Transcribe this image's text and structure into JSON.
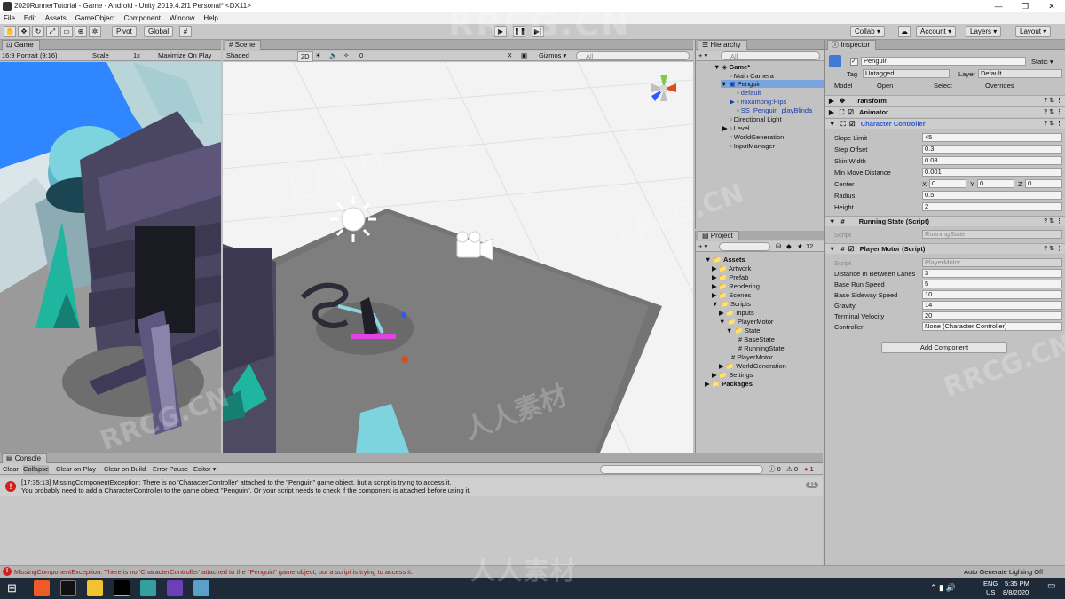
{
  "window": {
    "title": "2020RunnerTutorial - Game - Android - Unity 2019.4.2f1 Personal* <DX11>",
    "minimize": "—",
    "maximize": "❐",
    "close": "✕"
  },
  "menu": [
    "File",
    "Edit",
    "Assets",
    "GameObject",
    "Component",
    "Window",
    "Help"
  ],
  "toolbar": {
    "pivot": "Pivot",
    "global": "Global",
    "play": "▶",
    "pause": "❚❚",
    "step": "▶|",
    "collab": "Collab ▾",
    "account": "Account ▾",
    "layers": "Layers ▾",
    "layout": "Layout ▾"
  },
  "game": {
    "tab": "Game",
    "resolution": "16:9 Portrait (9:16)",
    "scale_label": "Scale",
    "scale_value": "1x",
    "maximize_on_play": "Maximize On Play"
  },
  "scene": {
    "tab": "Scene",
    "shading": "Shaded",
    "mode": "2D",
    "gizmos": "Gizmos ▾",
    "search_placeholder": "All",
    "layers_count": "0"
  },
  "hierarchy": {
    "tab": "Hierarchy",
    "search_placeholder": "All",
    "items": [
      {
        "label": "Game*",
        "depth": 0,
        "arrow": "▼",
        "scene": true
      },
      {
        "label": "Main Camera",
        "depth": 1,
        "arrow": ""
      },
      {
        "label": "Penguin",
        "depth": 1,
        "arrow": "▼",
        "selected": true
      },
      {
        "label": "default",
        "depth": 2,
        "arrow": "",
        "prefab": true
      },
      {
        "label": "mixamorig:Hips",
        "depth": 2,
        "arrow": "▶",
        "prefab": true
      },
      {
        "label": "SS_Penguin_playBlinda",
        "depth": 2,
        "arrow": "",
        "prefab": true
      },
      {
        "label": "Directional Light",
        "depth": 1,
        "arrow": ""
      },
      {
        "label": "Level",
        "depth": 1,
        "arrow": "▶"
      },
      {
        "label": "WorldGeneration",
        "depth": 1,
        "arrow": ""
      },
      {
        "label": "InputManager",
        "depth": 1,
        "arrow": ""
      }
    ]
  },
  "project": {
    "tab": "Project",
    "count": "12",
    "items": [
      {
        "label": "Assets",
        "depth": 0,
        "arrow": "▼",
        "bold": true
      },
      {
        "label": "Artwork",
        "depth": 1,
        "arrow": "▶"
      },
      {
        "label": "Prefab",
        "depth": 1,
        "arrow": "▶"
      },
      {
        "label": "Rendering",
        "depth": 1,
        "arrow": "▶"
      },
      {
        "label": "Scenes",
        "depth": 1,
        "arrow": "▶"
      },
      {
        "label": "Scripts",
        "depth": 1,
        "arrow": "▼"
      },
      {
        "label": "Inputs",
        "depth": 2,
        "arrow": "▶"
      },
      {
        "label": "PlayerMotor",
        "depth": 2,
        "arrow": "▼"
      },
      {
        "label": "State",
        "depth": 3,
        "arrow": "▼"
      },
      {
        "label": "BaseState",
        "depth": 4,
        "arrow": "",
        "script": true
      },
      {
        "label": "RunningState",
        "depth": 4,
        "arrow": "",
        "script": true
      },
      {
        "label": "PlayerMotor",
        "depth": 3,
        "arrow": "",
        "script": true
      },
      {
        "label": "WorldGeneration",
        "depth": 2,
        "arrow": "▶"
      },
      {
        "label": "Settings",
        "depth": 1,
        "arrow": "▶"
      },
      {
        "label": "Packages",
        "depth": 0,
        "arrow": "▶",
        "bold": true
      }
    ]
  },
  "inspector": {
    "tab": "Inspector",
    "object_name": "Penguin",
    "static_label": "Static ▾",
    "tag_label": "Tag",
    "tag_value": "Untagged",
    "layer_label": "Layer",
    "layer_value": "Default",
    "model_label": "Model",
    "open_label": "Open",
    "select_label": "Select",
    "overrides_label": "Overrides",
    "transform": "Transform",
    "animator": "Animator",
    "character_controller": "Character Controller",
    "cc_fields": [
      {
        "label": "Slope Limit",
        "value": "45"
      },
      {
        "label": "Step Offset",
        "value": "0.3"
      },
      {
        "label": "Skin Width",
        "value": "0.08"
      },
      {
        "label": "Min Move Distance",
        "value": "0.001"
      }
    ],
    "center_label": "Center",
    "center_x": "0",
    "center_y": "0",
    "center_z": "0",
    "radius_label": "Radius",
    "radius_value": "0.5",
    "height_label": "Height",
    "height_value": "2",
    "running_state": "Running State (Script)",
    "running_script_label": "Script",
    "running_script_value": "RunningState",
    "player_motor": "Player Motor (Script)",
    "motor_script_label": "Script",
    "motor_script_value": "PlayerMotor",
    "motor_fields": [
      {
        "label": "Distance In Between Lanes",
        "value": "3"
      },
      {
        "label": "Base Run Speed",
        "value": "5"
      },
      {
        "label": "Base Sideway Speed",
        "value": "10"
      },
      {
        "label": "Gravity",
        "value": "14"
      },
      {
        "label": "Terminal Velocity",
        "value": "20"
      },
      {
        "label": "Controller",
        "value": "None (Character Controller)"
      }
    ],
    "add_component": "Add Component"
  },
  "console": {
    "tab": "Console",
    "clear": "Clear",
    "collapse": "Collapse",
    "clear_on_play": "Clear on Play",
    "clear_on_build": "Clear on Build",
    "error_pause": "Error Pause",
    "editor": "Editor ▾",
    "log_count": "0",
    "warn_count": "0",
    "err_count": "1",
    "message_line1": "[17:35:13] MissingComponentException: There is no 'CharacterController' attached to the \"Penguin\" game object, but a script is trying to access it.",
    "message_line2": "You probably need to add a CharacterController to the game object \"Penguin\". Or your script needs to check if the component is attached before using it.",
    "message_count": "81"
  },
  "status": {
    "message": "MissingComponentException: There is no 'CharacterController' attached to the \"Penguin\" game object, but a script is trying to access it.",
    "right": "Auto Generate Lighting Off"
  },
  "taskbar": {
    "lang1": "ENG",
    "lang2": "US",
    "time": "5:35 PM",
    "date": "8/8/2020"
  },
  "watermark": {
    "text1": "RRCG.CN",
    "text2": "人人素材"
  }
}
